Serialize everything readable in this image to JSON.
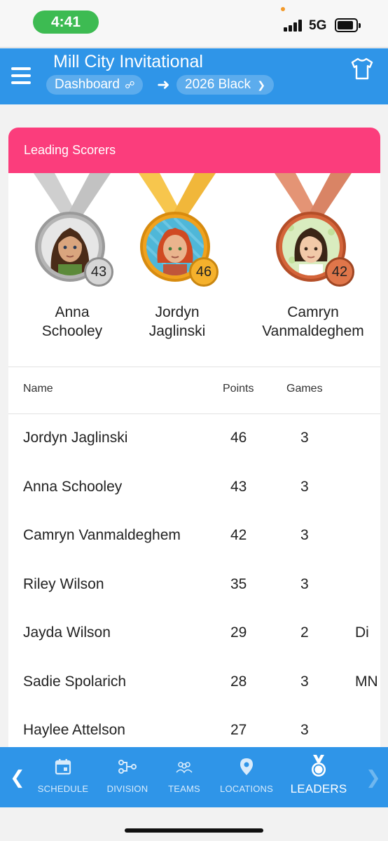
{
  "status_bar": {
    "time": "4:41",
    "network": "5G"
  },
  "header": {
    "title": "Mill City Invitational",
    "breadcrumb_dashboard": "Dashboard",
    "breadcrumb_team": "2026 Black",
    "menu_icon": "hamburger-icon",
    "jersey_icon": "jersey-icon"
  },
  "card": {
    "title": "Leading Scorers",
    "medals": [
      {
        "place": "silver",
        "first": "Anna",
        "last": "Schooley",
        "points": "43",
        "color": "#bdbdbd"
      },
      {
        "place": "gold",
        "first": "Jordyn",
        "last": "Jaglinski",
        "points": "46",
        "color": "#f3a726"
      },
      {
        "place": "bronze",
        "first": "Camryn",
        "last": "Vanmaldeghem",
        "points": "42",
        "color": "#d97a52"
      }
    ],
    "columns": {
      "name": "Name",
      "points": "Points",
      "games": "Games"
    },
    "rows": [
      {
        "name": "Jordyn Jaglinski",
        "points": "46",
        "games": "3",
        "extra": ""
      },
      {
        "name": "Anna Schooley",
        "points": "43",
        "games": "3",
        "extra": ""
      },
      {
        "name": "Camryn Vanmaldeghem",
        "points": "42",
        "games": "3",
        "extra": ""
      },
      {
        "name": "Riley Wilson",
        "points": "35",
        "games": "3",
        "extra": ""
      },
      {
        "name": "Jayda Wilson",
        "points": "29",
        "games": "2",
        "extra": "Di"
      },
      {
        "name": "Sadie Spolarich",
        "points": "28",
        "games": "3",
        "extra": "MN"
      },
      {
        "name": "Haylee Attelson",
        "points": "27",
        "games": "3",
        "extra": ""
      }
    ]
  },
  "bottom_nav": {
    "items": [
      {
        "label": "SCHEDULE",
        "icon": "calendar-icon"
      },
      {
        "label": "DIVISION",
        "icon": "bracket-icon"
      },
      {
        "label": "TEAMS",
        "icon": "people-icon"
      },
      {
        "label": "LOCATIONS",
        "icon": "map-pin-icon"
      },
      {
        "label": "LEADERS",
        "icon": "medal-icon"
      }
    ],
    "active": "LEADERS"
  },
  "colors": {
    "header": "#2f95e8",
    "card_header": "#fb3d7c",
    "time_pill": "#3dbb52"
  }
}
